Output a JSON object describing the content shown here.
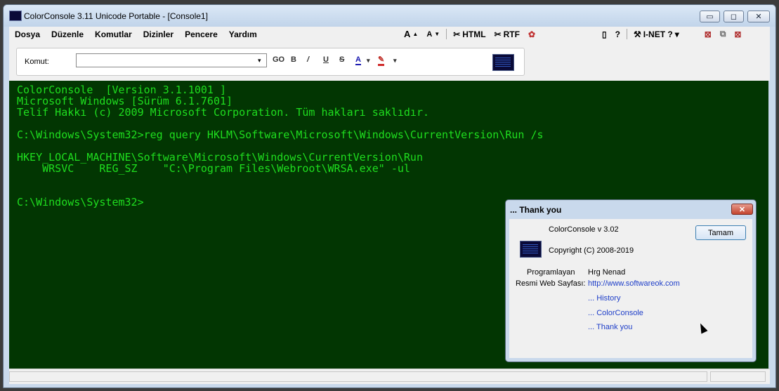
{
  "window": {
    "title": "ColorConsole 3.11  Unicode Portable - [Console1]",
    "minimize_glyph": "▭",
    "maximize_glyph": "◻",
    "close_glyph": "✕"
  },
  "menu": {
    "items": [
      "Dosya",
      "Düzenle",
      "Komutlar",
      "Dizinler",
      "Pencere",
      "Yardım"
    ]
  },
  "menu_tools": {
    "font_up": "A",
    "font_down": "A",
    "html_label": "HTML",
    "rtf_label": "RTF",
    "help_glyph": "?",
    "inet_label": "I-NET ?",
    "inet_arrow": "▾"
  },
  "cmdbar": {
    "label": "Komut:",
    "value": "",
    "dropdown_glyph": "▾",
    "go_label": "GO",
    "bold_label": "B",
    "italic_label": "/",
    "underline_label": "U",
    "strike_label": "S",
    "fontcolor_label": "A",
    "fontcolor_arrow": "▾",
    "highlight_arrow": "▾"
  },
  "console": {
    "lines": [
      "ColorConsole  [Version 3.1.1001 ]",
      "Microsoft Windows [Sürüm 6.1.7601]",
      "Telif Hakkı (c) 2009 Microsoft Corporation. Tüm hakları saklıdır.",
      "C:\\Windows\\System32>reg query HKLM\\Software\\Microsoft\\Windows\\CurrentVersion\\Run /s",
      "HKEY_LOCAL_MACHINE\\Software\\Microsoft\\Windows\\CurrentVersion\\Run",
      "    WRSVC    REG_SZ    \"C:\\Program Files\\Webroot\\WRSA.exe\" -ul",
      "C:\\Windows\\System32>"
    ],
    "text_color": "#1fde1f",
    "bg_color": "#023602"
  },
  "dialog": {
    "title": "... Thank you",
    "close_glyph": "✕",
    "version": "ColorConsole v 3.02",
    "copyright": "Copyright (C) 2008-2019",
    "ok_label": "Tamam",
    "programmer_label": "Programlayan",
    "programmer_value": "Hrg Nenad",
    "website_label": "Resmi Web Sayfası:",
    "website_value": "http://www.softwareok.com",
    "links": [
      "... History",
      "... ColorConsole",
      "... Thank you"
    ]
  }
}
